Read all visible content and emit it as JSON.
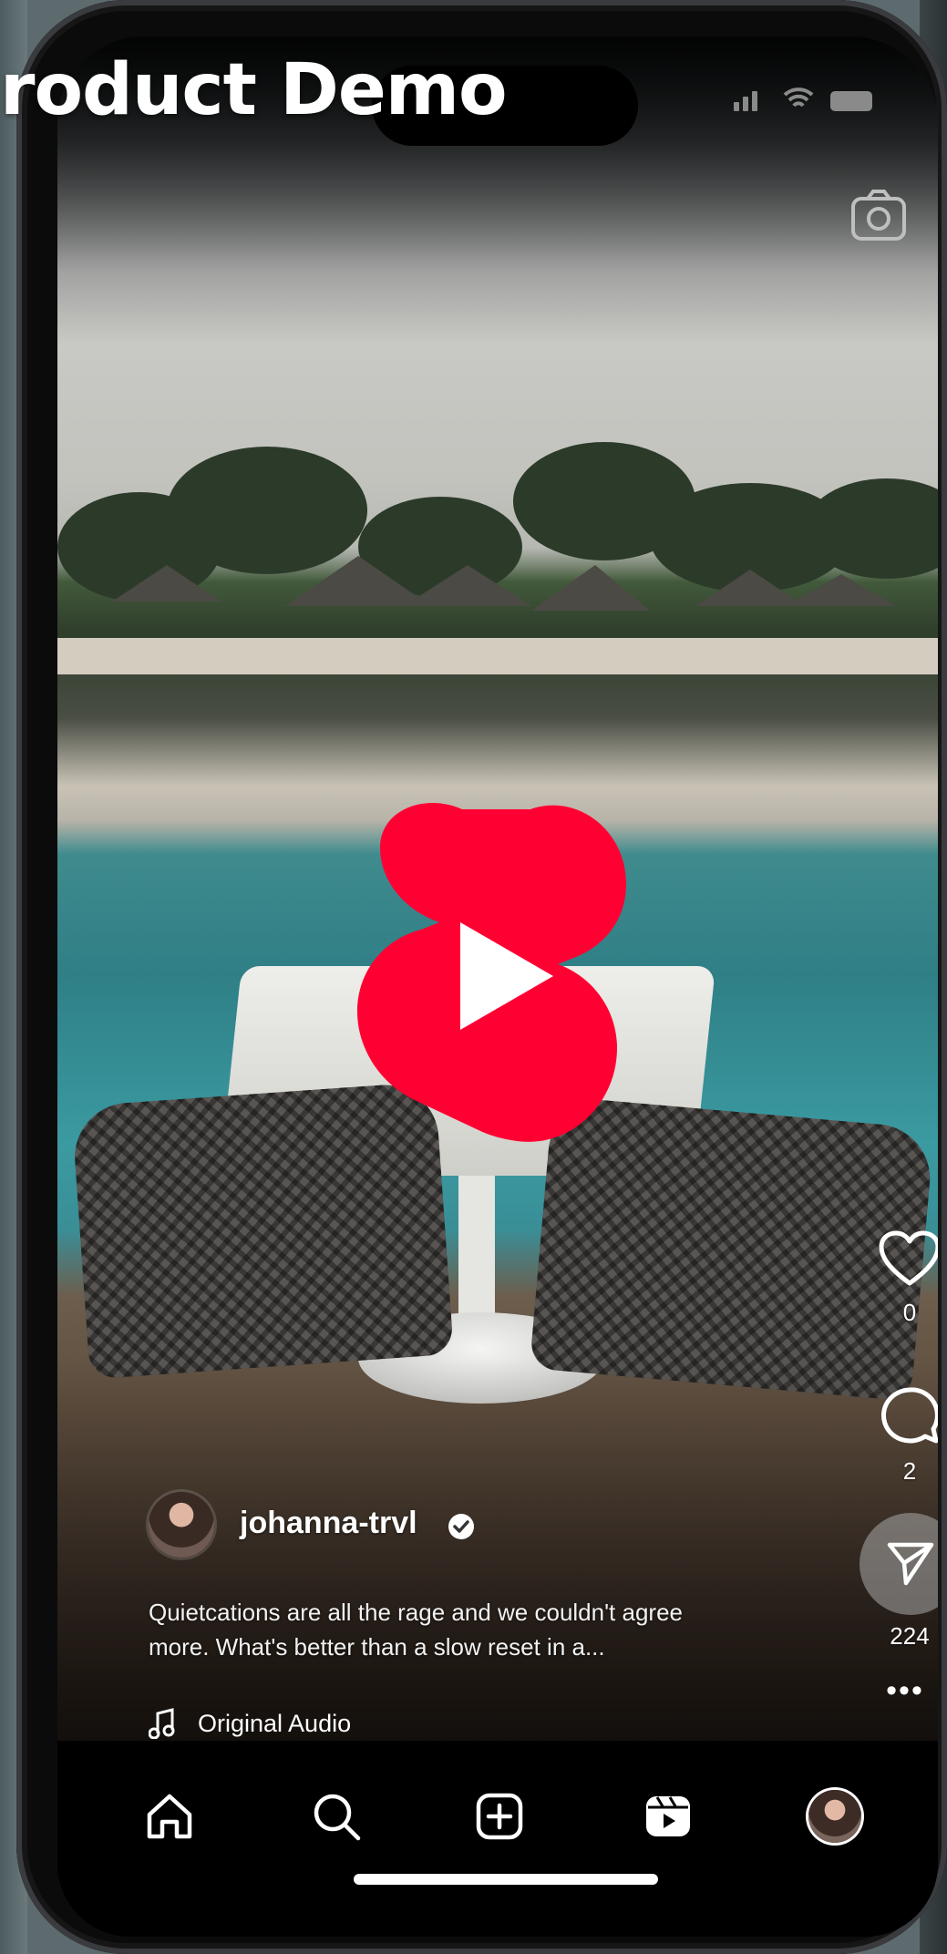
{
  "overlay": {
    "title": "roduct Demo"
  },
  "post": {
    "username": "johanna-trvl",
    "verified": true,
    "caption_line1": "Quietcations are all the rage and we couldn't agree",
    "caption_line2": "more. What's better than a slow reset in a...",
    "audio_label": "Original Audio"
  },
  "actions": {
    "likes": "0",
    "comments": "2",
    "shares": "224"
  },
  "tabs": [
    {
      "icon": "home-icon"
    },
    {
      "icon": "search-icon"
    },
    {
      "icon": "create-icon"
    },
    {
      "icon": "reels-icon"
    },
    {
      "icon": "profile-avatar"
    }
  ],
  "colors": {
    "shorts_red": "#ff0033",
    "tabbar_bg": "#000000"
  }
}
